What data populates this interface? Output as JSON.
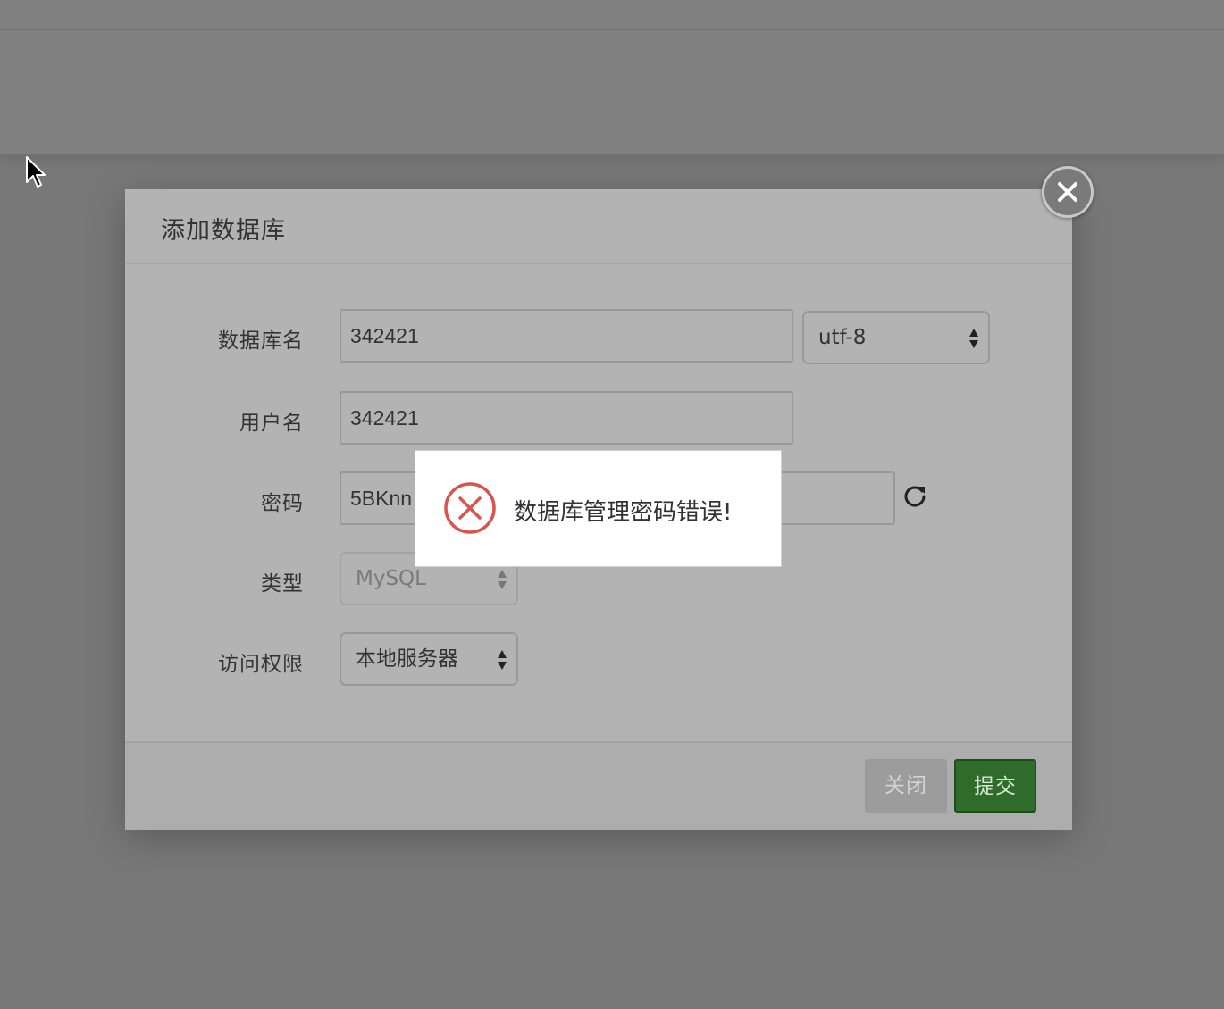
{
  "modal": {
    "title": "添加数据库",
    "fields": {
      "db_name": {
        "label": "数据库名",
        "value": "342421"
      },
      "charset": {
        "value": "utf-8"
      },
      "username": {
        "label": "用户名",
        "value": "342421"
      },
      "password": {
        "label": "密码",
        "value": "5BKnn"
      },
      "type": {
        "label": "类型",
        "value": "MySQL"
      },
      "access": {
        "label": "访问权限",
        "value": "本地服务器"
      }
    },
    "footer": {
      "close_label": "关闭",
      "submit_label": "提交"
    }
  },
  "toast": {
    "message": "数据库管理密码错误!",
    "icon": "error-circle-icon"
  },
  "colors": {
    "submit_green": "#2f6c2c",
    "error_red": "#d9534f"
  }
}
